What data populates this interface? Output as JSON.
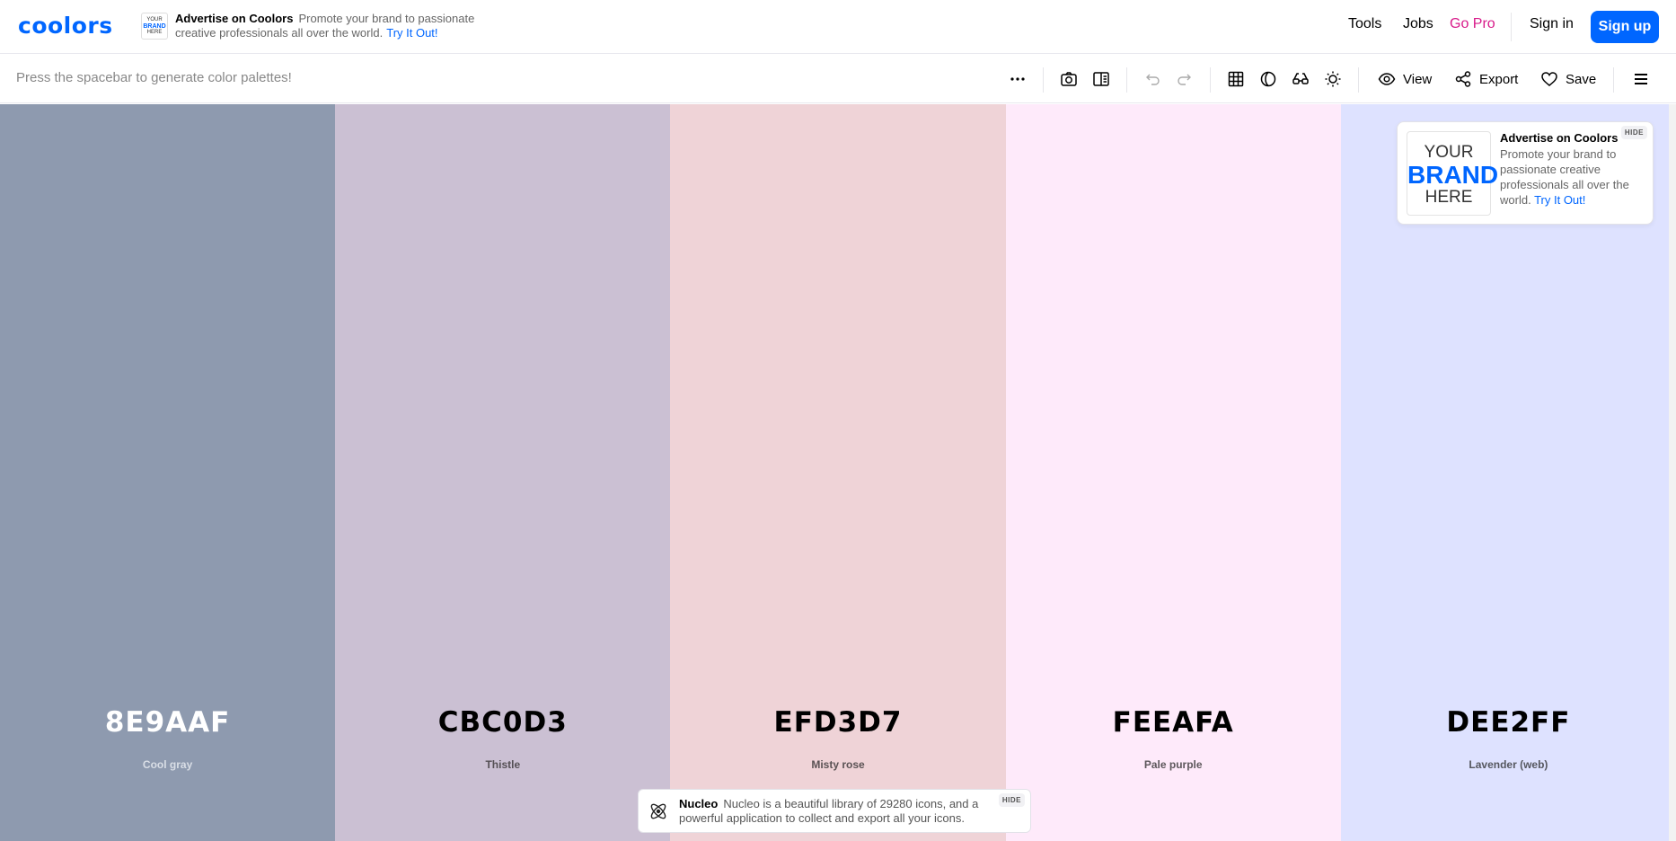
{
  "header": {
    "logo": "coolors",
    "ad": {
      "mini_top": "YOUR",
      "mini_brand": "BRAND",
      "mini_bottom": "HERE",
      "title": "Advertise on Coolors",
      "text": "Promote your brand to passionate creative professionals all over the world.",
      "link": "Try It Out!"
    },
    "nav": {
      "tools": "Tools",
      "jobs": "Jobs",
      "go_pro": "Go Pro",
      "sign_in": "Sign in",
      "sign_up": "Sign up"
    }
  },
  "toolbar": {
    "hint": "Press the spacebar to generate color palettes!",
    "view_label": "View",
    "export_label": "Export",
    "save_label": "Save",
    "icons": [
      "more-icon",
      "camera-icon",
      "split-view-icon",
      "undo-icon",
      "redo-icon",
      "grid-icon",
      "contrast-icon",
      "glasses-icon",
      "brightness-icon",
      "eye-icon",
      "share-icon",
      "heart-icon",
      "menu-icon"
    ]
  },
  "palette": [
    {
      "hex": "8E9AAF",
      "name": "Cool gray",
      "color": "#8E9AAF",
      "text_color": "#ffffff",
      "name_color": "#d9dee6"
    },
    {
      "hex": "CBC0D3",
      "name": "Thistle",
      "color": "#CBC0D3",
      "text_color": "#000000",
      "name_color": "#555055"
    },
    {
      "hex": "EFD3D7",
      "name": "Misty rose",
      "color": "#EFD3D7",
      "text_color": "#000000",
      "name_color": "#5a5254"
    },
    {
      "hex": "FEEAFA",
      "name": "Pale purple",
      "color": "#FEEAFA",
      "text_color": "#000000",
      "name_color": "#5e585c"
    },
    {
      "hex": "DEE2FF",
      "name": "Lavender (web)",
      "color": "#DEE2FF",
      "text_color": "#000000",
      "name_color": "#55575f"
    }
  ],
  "side_ad": {
    "brand_top": "YOUR",
    "brand_mid": "BRAND",
    "brand_bottom": "HERE",
    "title": "Advertise on Coolors",
    "text": "Promote your brand to passionate creative professionals all over the world.",
    "link": "Try It Out!",
    "hide": "HIDE"
  },
  "bottom_ad": {
    "title": "Nucleo",
    "text": "Nucleo is a beautiful library of 29280 icons, and a powerful application to collect and export all your icons.",
    "hide": "HIDE"
  },
  "colors": {
    "accent": "#0066ff",
    "pro": "#d81b8a"
  }
}
